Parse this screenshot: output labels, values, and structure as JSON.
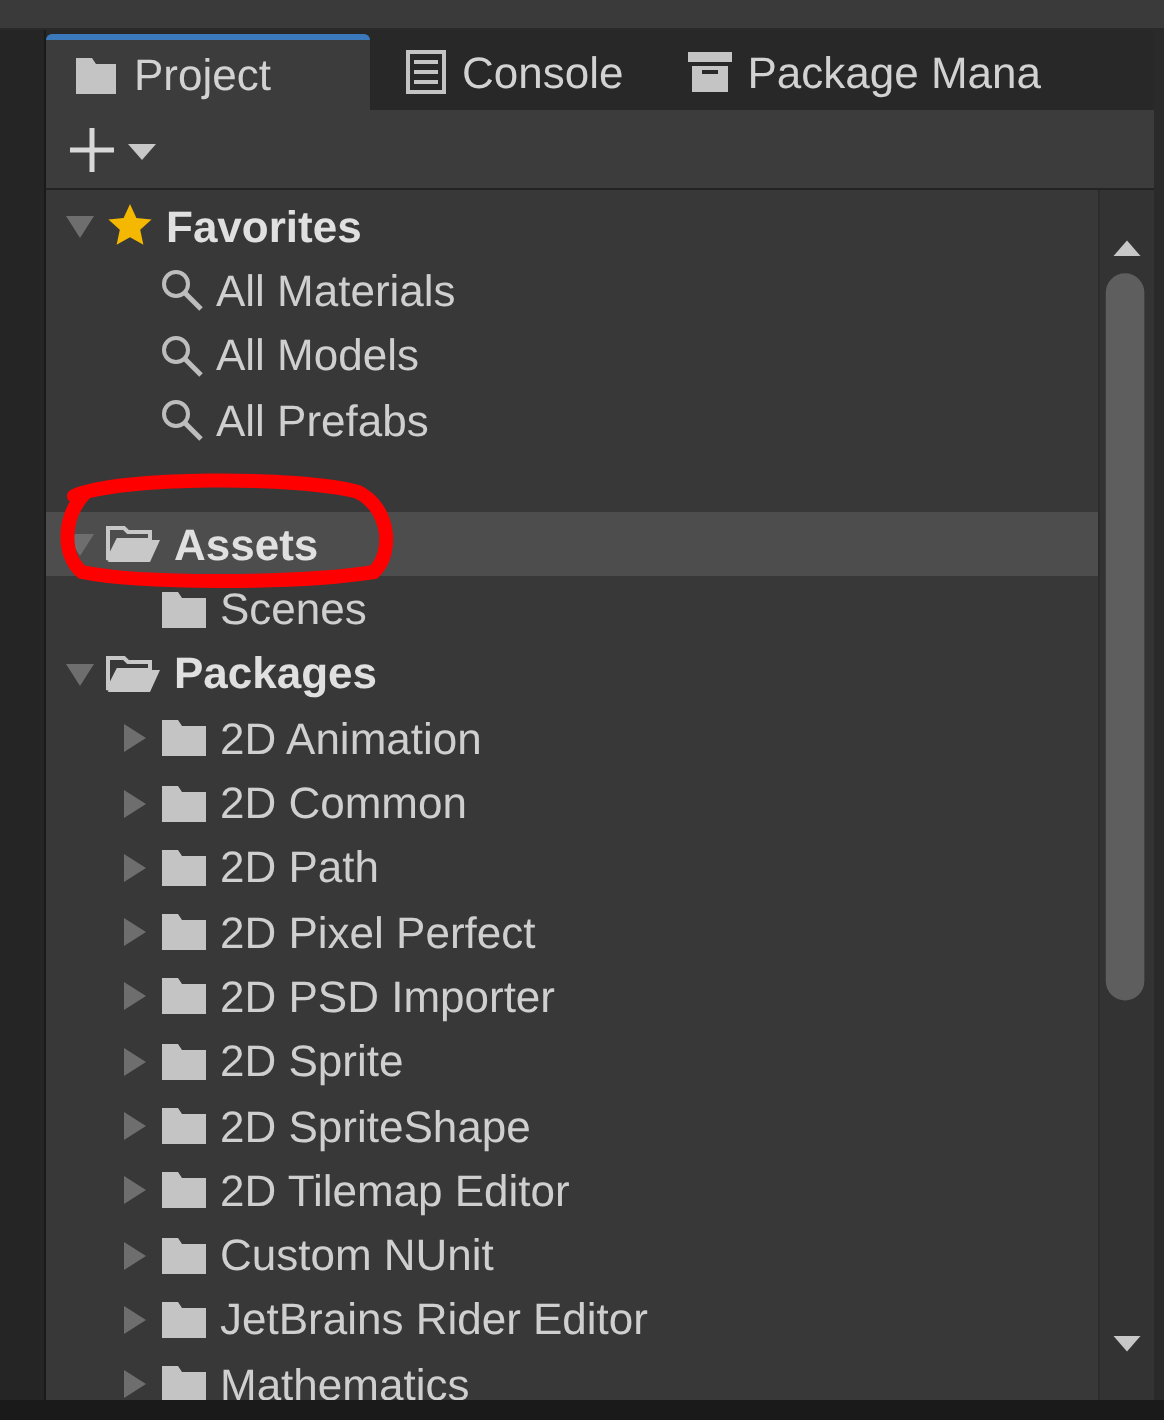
{
  "tabs": [
    {
      "label": "Project",
      "kind": "project",
      "selected": true
    },
    {
      "label": "Console",
      "kind": "console",
      "selected": false
    },
    {
      "label": "Package Mana",
      "kind": "package",
      "selected": false
    }
  ],
  "tree": [
    {
      "label": "Favorites",
      "kind": "favorites",
      "expanded": true,
      "selected": false,
      "children": [
        {
          "label": "All Materials",
          "kind": "search",
          "selected": false
        },
        {
          "label": "All Models",
          "kind": "search",
          "selected": false
        },
        {
          "label": "All Prefabs",
          "kind": "search",
          "selected": false
        }
      ]
    },
    {
      "label": "Assets",
      "kind": "folder",
      "expanded": true,
      "selected": true,
      "children": [
        {
          "label": "Scenes",
          "kind": "folder",
          "selected": false
        }
      ]
    },
    {
      "label": "Packages",
      "kind": "folder",
      "expanded": true,
      "selected": false,
      "children": [
        {
          "label": "2D Animation",
          "kind": "folder",
          "expanded": false,
          "selected": false
        },
        {
          "label": "2D Common",
          "kind": "folder",
          "expanded": false,
          "selected": false
        },
        {
          "label": "2D Path",
          "kind": "folder",
          "expanded": false,
          "selected": false
        },
        {
          "label": "2D Pixel Perfect",
          "kind": "folder",
          "expanded": false,
          "selected": false
        },
        {
          "label": "2D PSD Importer",
          "kind": "folder",
          "expanded": false,
          "selected": false
        },
        {
          "label": "2D Sprite",
          "kind": "folder",
          "expanded": false,
          "selected": false
        },
        {
          "label": "2D SpriteShape",
          "kind": "folder",
          "expanded": false,
          "selected": false
        },
        {
          "label": "2D Tilemap Editor",
          "kind": "folder",
          "expanded": false,
          "selected": false
        },
        {
          "label": "Custom NUnit",
          "kind": "folder",
          "expanded": false,
          "selected": false
        },
        {
          "label": "JetBrains Rider Editor",
          "kind": "folder",
          "expanded": false,
          "selected": false
        },
        {
          "label": "Mathematics",
          "kind": "folder",
          "expanded": false,
          "selected": false
        }
      ]
    }
  ]
}
